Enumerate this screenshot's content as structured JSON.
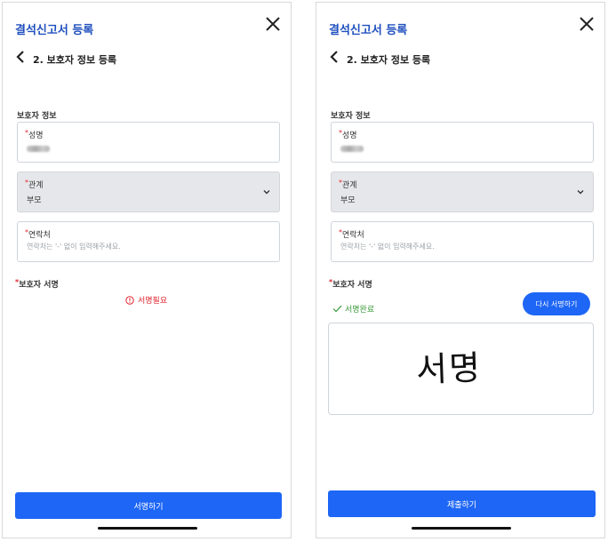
{
  "left": {
    "title": "결석신고서 등록",
    "step": "2. 보호자 정보 등록",
    "section_title": "보호자 정보",
    "fields": {
      "name": {
        "label": "성명",
        "required": "*"
      },
      "relation": {
        "label": "관계",
        "required": "*",
        "value": "부모"
      },
      "contact": {
        "label": "연락처",
        "required": "*",
        "placeholder": "연락처는 '-' 없이 입력해주세요."
      }
    },
    "signature_label": "보호자 서명",
    "signature_required": "*",
    "signature_status": "서명필요",
    "button": "서명하기"
  },
  "right": {
    "title": "결석신고서 등록",
    "step": "2. 보호자 정보 등록",
    "section_title": "보호자 정보",
    "fields": {
      "name": {
        "label": "성명",
        "required": "*"
      },
      "relation": {
        "label": "관계",
        "required": "*",
        "value": "부모"
      },
      "contact": {
        "label": "연락처",
        "required": "*",
        "placeholder": "연락처는 '-' 없이 입력해주세요."
      }
    },
    "signature_label": "보호자 서명",
    "signature_required": "*",
    "signature_status": "서명완료",
    "resign_button": "다시 서명하기",
    "signature_image_text": "서명",
    "button": "제출하기"
  },
  "colors": {
    "accent": "#1e66f5",
    "title": "#1f4fbf",
    "error": "#e2262f",
    "success": "#3a9a3a"
  }
}
